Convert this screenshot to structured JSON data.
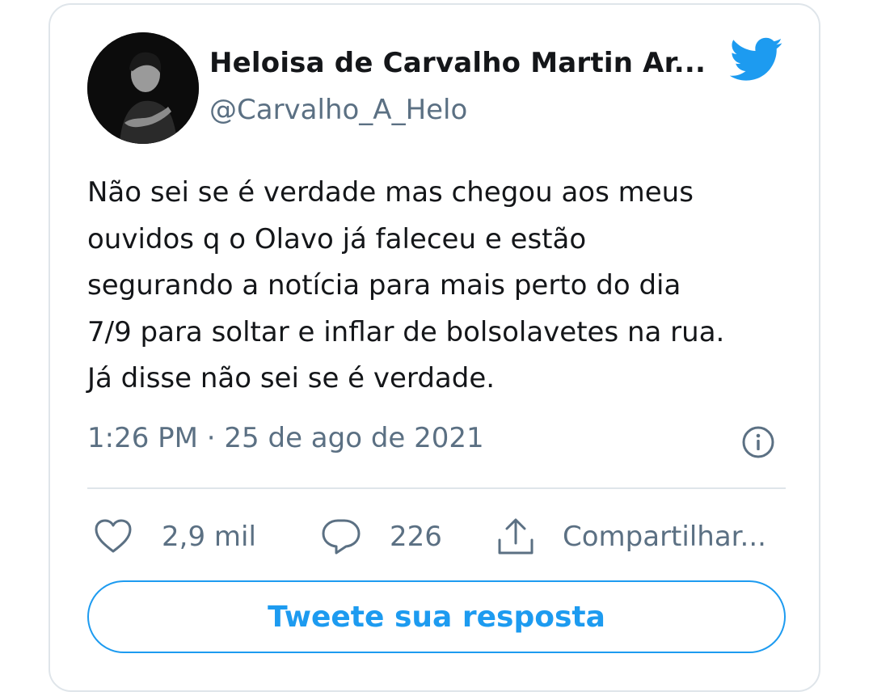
{
  "author": {
    "display_name": "Heloisa de Carvalho Martin Ar...",
    "handle": "@Carvalho_A_Helo",
    "avatar_icon": "profile-photo"
  },
  "brand": {
    "logo_icon": "twitter-bird-icon",
    "color": "#1d9bf0"
  },
  "tweet": {
    "lines": [
      "Não sei se é verdade mas chegou aos meus",
      "ouvidos q o Olavo já faleceu e estão",
      "segurando a notícia para mais perto do dia",
      "7/9 para soltar e inflar de bolsolavetes na rua.",
      "Já disse não sei se é verdade."
    ],
    "timestamp": "1:26 PM · 25 de ago de 2021"
  },
  "actions": {
    "like_count": "2,9 mil",
    "reply_count": "226",
    "share_label": "Compartilhar..."
  },
  "reply_button": {
    "label": "Tweete sua resposta"
  }
}
